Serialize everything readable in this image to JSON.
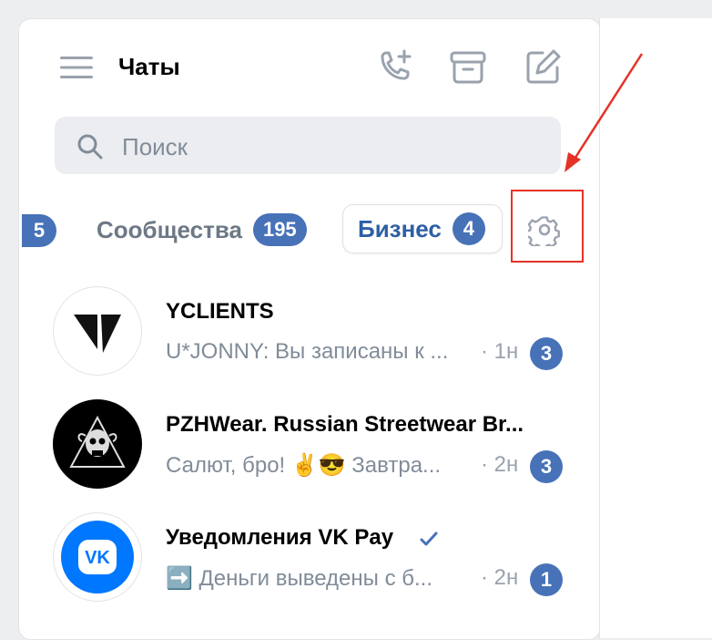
{
  "header": {
    "title": "Чаты",
    "icons": [
      "menu-icon",
      "phone-add-icon",
      "archive-icon",
      "compose-icon"
    ]
  },
  "search": {
    "placeholder": "Поиск"
  },
  "tabs": {
    "partial_badge": "5",
    "communities": {
      "label": "Сообщества",
      "count": "195"
    },
    "business": {
      "label": "Бизнес",
      "count": "4"
    }
  },
  "chats": [
    {
      "name": "YCLIENTS",
      "message": "U*JONNY: Вы записаны к ...",
      "time": "· 1н",
      "unread": "3"
    },
    {
      "name": "PZHWear. Russian Streetwear Br...",
      "message": "Салют, бро! ✌️😎 Завтра...",
      "time": "· 2н",
      "unread": "3"
    },
    {
      "name": "Уведомления VK Pay",
      "message": "➡️ Деньги выведены с б...",
      "time": "· 2н",
      "unread": "1",
      "verified": true
    }
  ],
  "colors": {
    "accent": "#4772b8",
    "business_text": "#2d5fa5",
    "highlight": "#e53227",
    "vk_blue": "#0077ff"
  }
}
